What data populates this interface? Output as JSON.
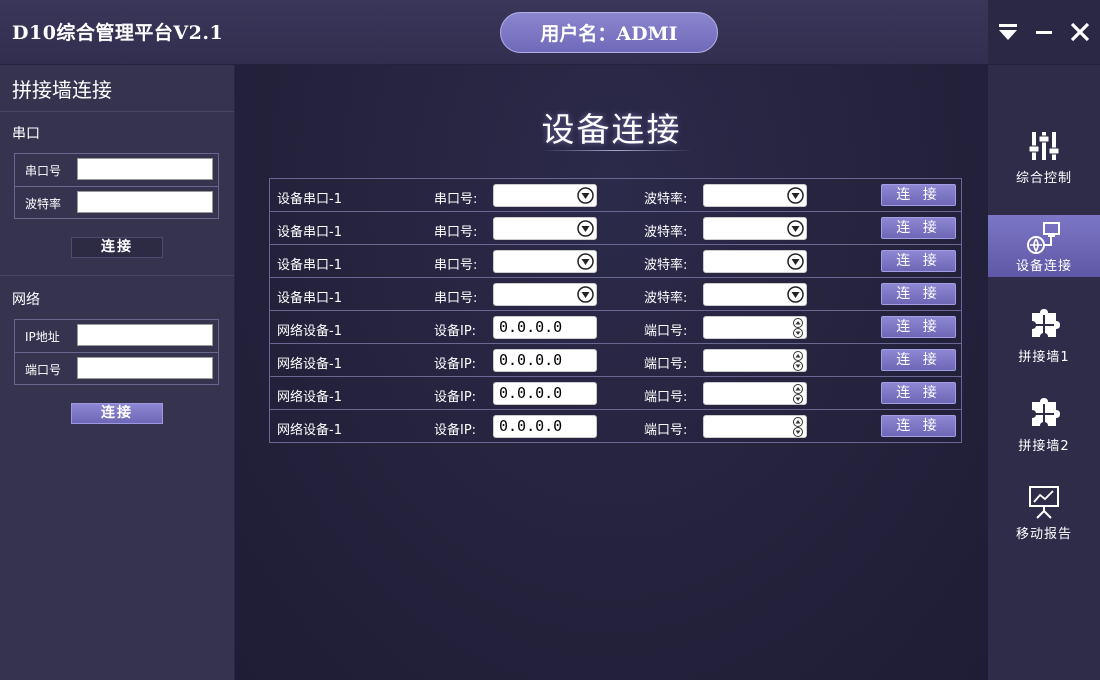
{
  "app": {
    "title": "D10综合管理平台V2.1",
    "user_label": "用户名：ADMI"
  },
  "window_controls": {
    "icons": [
      "dropdown-icon",
      "minimize-icon",
      "close-icon"
    ]
  },
  "left": {
    "heading": "拼接墙连接",
    "serial": {
      "section": "串口",
      "port_label": "串口号",
      "baud_label": "波特率",
      "button": "连接"
    },
    "network": {
      "section": "网络",
      "ip_label": "IP地址",
      "port_label": "端口号",
      "button": "连接"
    }
  },
  "main": {
    "title": "设备连接",
    "rows": [
      {
        "name": "设备串口-1",
        "f1": "串口号:",
        "f2": "波特率:",
        "button": "连 接"
      },
      {
        "name": "设备串口-1",
        "f1": "串口号:",
        "f2": "波特率:",
        "button": "连 接"
      },
      {
        "name": "设备串口-1",
        "f1": "串口号:",
        "f2": "波特率:",
        "button": "连 接"
      },
      {
        "name": "设备串口-1",
        "f1": "串口号:",
        "f2": "波特率:",
        "button": "连 接"
      },
      {
        "name": "网络设备-1",
        "f1": "设备IP:",
        "ip": "0.0.0.0",
        "f2": "端口号:",
        "button": "连 接"
      },
      {
        "name": "网络设备-1",
        "f1": "设备IP:",
        "ip": "0.0.0.0",
        "f2": "端口号:",
        "button": "连 接"
      },
      {
        "name": "网络设备-1",
        "f1": "设备IP:",
        "ip": "0.0.0.0",
        "f2": "端口号:",
        "button": "连 接"
      },
      {
        "name": "网络设备-1",
        "f1": "设备IP:",
        "ip": "0.0.0.0",
        "f2": "端口号:",
        "button": "连 接"
      }
    ]
  },
  "nav": {
    "items": [
      {
        "label": "综合控制",
        "icon": "sliders-icon",
        "active": false
      },
      {
        "label": "设备连接",
        "icon": "device-link-icon",
        "active": true
      },
      {
        "label": "拼接墙1",
        "icon": "puzzle-icon",
        "active": false
      },
      {
        "label": "拼接墙2",
        "icon": "puzzle-icon",
        "active": false
      },
      {
        "label": "移动报告",
        "icon": "presentation-icon",
        "active": false
      }
    ]
  },
  "colors": {
    "accent": "#7c76c6",
    "background": "#27243f",
    "panel": "#36334f"
  }
}
